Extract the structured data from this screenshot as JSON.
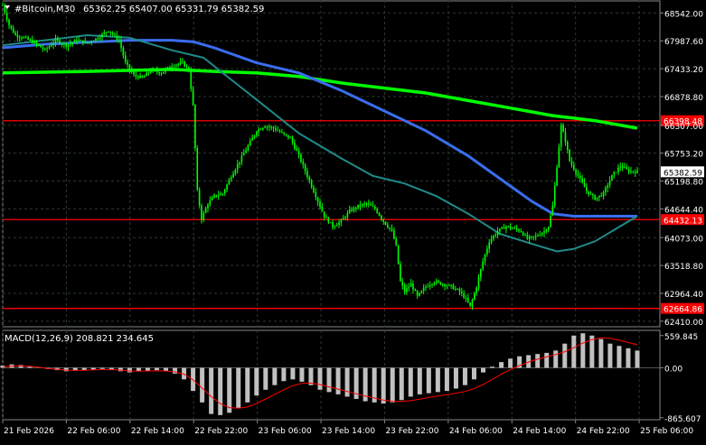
{
  "header": {
    "symbol_label": "#Bitcoin,M30",
    "ohlc": "65362.25 65407.00 65331.79 65382.59"
  },
  "indicator_label": "MACD(12,26,9) 208.821 234.645",
  "colors": {
    "background": "#000000",
    "grid": "#2a3a2a",
    "axis_text": "#ffffff",
    "candle": "#00ff00",
    "sma_green": "#00ff00",
    "sma_blue": "#3a6df0",
    "sma_teal": "#208a8a",
    "level_line": "#ff0000",
    "macd_hist": "#c0c0c0",
    "macd_signal": "#ff0000"
  },
  "chart_data": [
    {
      "type": "candlestick",
      "title": "#Bitcoin,M30",
      "ylim": [
        62300,
        68800
      ],
      "price_ticks": [
        "68542.00",
        "67987.60",
        "67433.20",
        "66878.80",
        "66307.00",
        "65753.20",
        "65198.80",
        "64644.40",
        "64073.00",
        "63518.80",
        "62964.40",
        "62410.00"
      ],
      "x_ticks": [
        "21 Feb 2026",
        "22 Feb 06:00",
        "22 Feb 14:00",
        "22 Feb 22:00",
        "23 Feb 06:00",
        "23 Feb 14:00",
        "23 Feb 22:00",
        "24 Feb 06:00",
        "24 Feb 14:00",
        "24 Feb 22:00",
        "25 Feb 06:00"
      ],
      "current_price": "65382.59",
      "horizontal_levels": [
        "66398.48",
        "64432.13",
        "62664.86"
      ],
      "close_path": [
        [
          0,
          68700
        ],
        [
          3,
          68300
        ],
        [
          6,
          68100
        ],
        [
          10,
          68050
        ],
        [
          15,
          67950
        ],
        [
          20,
          67800
        ],
        [
          25,
          68000
        ],
        [
          30,
          67900
        ],
        [
          35,
          68000
        ],
        [
          40,
          67950
        ],
        [
          45,
          68050
        ],
        [
          50,
          68200
        ],
        [
          55,
          68000
        ],
        [
          58,
          67550
        ],
        [
          62,
          67300
        ],
        [
          66,
          67250
        ],
        [
          70,
          67400
        ],
        [
          75,
          67350
        ],
        [
          80,
          67500
        ],
        [
          85,
          67550
        ],
        [
          88,
          67400
        ],
        [
          90,
          66700
        ],
        [
          92,
          65000
        ],
        [
          94,
          64450
        ],
        [
          97,
          64750
        ],
        [
          100,
          64900
        ],
        [
          104,
          64950
        ],
        [
          108,
          65300
        ],
        [
          112,
          65600
        ],
        [
          116,
          65900
        ],
        [
          120,
          66200
        ],
        [
          124,
          66300
        ],
        [
          128,
          66250
        ],
        [
          132,
          66150
        ],
        [
          136,
          66050
        ],
        [
          140,
          65700
        ],
        [
          144,
          65300
        ],
        [
          148,
          64900
        ],
        [
          152,
          64500
        ],
        [
          156,
          64300
        ],
        [
          160,
          64400
        ],
        [
          164,
          64600
        ],
        [
          168,
          64700
        ],
        [
          172,
          64750
        ],
        [
          176,
          64650
        ],
        [
          180,
          64400
        ],
        [
          184,
          64200
        ],
        [
          186,
          63900
        ],
        [
          188,
          63200
        ],
        [
          190,
          63000
        ],
        [
          193,
          63150
        ],
        [
          196,
          62900
        ],
        [
          200,
          63100
        ],
        [
          204,
          63200
        ],
        [
          208,
          63150
        ],
        [
          212,
          63100
        ],
        [
          216,
          63000
        ],
        [
          219,
          62850
        ],
        [
          221,
          62700
        ],
        [
          224,
          63100
        ],
        [
          227,
          63600
        ],
        [
          230,
          64000
        ],
        [
          234,
          64200
        ],
        [
          238,
          64300
        ],
        [
          242,
          64250
        ],
        [
          245,
          64200
        ],
        [
          248,
          64050
        ],
        [
          252,
          64100
        ],
        [
          256,
          64200
        ],
        [
          258,
          64300
        ],
        [
          260,
          64700
        ],
        [
          262,
          65500
        ],
        [
          264,
          66300
        ],
        [
          266,
          66000
        ],
        [
          268,
          65600
        ],
        [
          272,
          65300
        ],
        [
          276,
          65000
        ],
        [
          280,
          64850
        ],
        [
          284,
          64950
        ],
        [
          288,
          65300
        ],
        [
          292,
          65500
        ],
        [
          296,
          65400
        ],
        [
          300,
          65380
        ]
      ],
      "series": [
        {
          "name": "",
          "color": "#00ff00",
          "points": [
            [
              0,
              67350
            ],
            [
              40,
              67380
            ],
            [
              80,
              67420
            ],
            [
              100,
              67380
            ],
            [
              120,
              67350
            ],
            [
              140,
              67280
            ],
            [
              160,
              67150
            ],
            [
              180,
              67050
            ],
            [
              200,
              66950
            ],
            [
              220,
              66800
            ],
            [
              240,
              66650
            ],
            [
              260,
              66500
            ],
            [
              280,
              66400
            ],
            [
              300,
              66250
            ]
          ]
        },
        {
          "name": "",
          "color": "#3a6df0",
          "points": [
            [
              0,
              67850
            ],
            [
              20,
              67920
            ],
            [
              40,
              67960
            ],
            [
              60,
              68000
            ],
            [
              80,
              68000
            ],
            [
              90,
              67970
            ],
            [
              100,
              67850
            ],
            [
              120,
              67550
            ],
            [
              140,
              67350
            ],
            [
              160,
              67000
            ],
            [
              180,
              66600
            ],
            [
              200,
              66200
            ],
            [
              220,
              65700
            ],
            [
              240,
              65100
            ],
            [
              250,
              64800
            ],
            [
              260,
              64550
            ],
            [
              270,
              64500
            ],
            [
              280,
              64500
            ],
            [
              290,
              64500
            ],
            [
              300,
              64500
            ]
          ]
        },
        {
          "name": "",
          "color": "#208a8a",
          "points": [
            [
              0,
              67900
            ],
            [
              20,
              68000
            ],
            [
              40,
              68100
            ],
            [
              60,
              68050
            ],
            [
              80,
              67800
            ],
            [
              95,
              67650
            ],
            [
              110,
              67150
            ],
            [
              125,
              66650
            ],
            [
              140,
              66150
            ],
            [
              160,
              65650
            ],
            [
              175,
              65300
            ],
            [
              190,
              65150
            ],
            [
              205,
              64900
            ],
            [
              220,
              64550
            ],
            [
              235,
              64150
            ],
            [
              250,
              63950
            ],
            [
              262,
              63800
            ],
            [
              270,
              63850
            ],
            [
              280,
              64000
            ],
            [
              290,
              64250
            ],
            [
              300,
              64500
            ]
          ]
        }
      ]
    },
    {
      "type": "bar",
      "title": "MACD(12,26,9)",
      "ylim": [
        -900,
        650
      ],
      "ticks": [
        "559.845",
        "0.00",
        "-865.607"
      ],
      "histogram": [
        40,
        60,
        50,
        30,
        10,
        -20,
        -40,
        -60,
        -50,
        -40,
        -30,
        -20,
        -40,
        -60,
        -80,
        -60,
        -50,
        -40,
        -60,
        -100,
        -200,
        -400,
        -600,
        -800,
        -820,
        -780,
        -700,
        -600,
        -480,
        -380,
        -300,
        -230,
        -200,
        -240,
        -300,
        -380,
        -420,
        -460,
        -500,
        -540,
        -580,
        -600,
        -620,
        -600,
        -560,
        -500,
        -460,
        -440,
        -420,
        -400,
        -360,
        -300,
        -200,
        -80,
        20,
        100,
        160,
        200,
        220,
        240,
        260,
        300,
        420,
        560,
        600,
        560,
        500,
        420,
        380,
        340,
        300
      ],
      "signal": [
        20,
        30,
        35,
        25,
        10,
        -10,
        -25,
        -40,
        -45,
        -42,
        -36,
        -30,
        -30,
        -40,
        -55,
        -58,
        -55,
        -50,
        -55,
        -70,
        -110,
        -210,
        -350,
        -500,
        -620,
        -690,
        -700,
        -680,
        -620,
        -540,
        -460,
        -380,
        -310,
        -270,
        -265,
        -290,
        -330,
        -370,
        -410,
        -450,
        -490,
        -525,
        -560,
        -580,
        -585,
        -570,
        -545,
        -515,
        -490,
        -465,
        -440,
        -410,
        -360,
        -290,
        -200,
        -110,
        -30,
        40,
        100,
        150,
        190,
        230,
        280,
        350,
        430,
        490,
        520,
        510,
        480,
        440,
        400
      ]
    }
  ]
}
